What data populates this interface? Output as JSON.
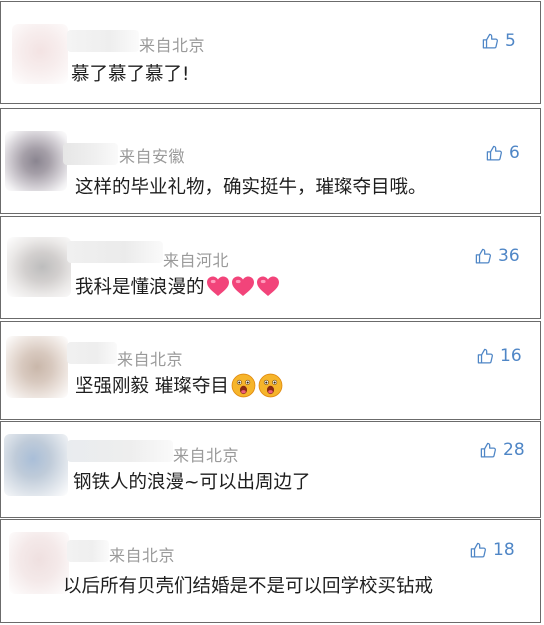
{
  "comments": [
    {
      "region": "来自北京",
      "text": "慕了慕了慕了!",
      "likes": "5",
      "emoji": null,
      "emoji_count": 0
    },
    {
      "region": "来自安徽",
      "text": "这样的毕业礼物，确实挺牛，璀璨夺目哦。",
      "likes": "6",
      "emoji": null,
      "emoji_count": 0
    },
    {
      "region": "来自河北",
      "text": "我科是懂浪漫的",
      "likes": "36",
      "emoji": "heart-emoji",
      "emoji_count": 3
    },
    {
      "region": "来自北京",
      "text": "坚强刚毅 璀璨夺目",
      "likes": "16",
      "emoji": "surprised-face-emoji",
      "emoji_count": 2
    },
    {
      "region": "来自北京",
      "text": "钢铁人的浪漫~可以出周边了",
      "likes": "28",
      "emoji": null,
      "emoji_count": 0
    },
    {
      "region": "来自北京",
      "text": "以后所有贝壳们结婚是不是可以回学校买钻戒",
      "likes": "18",
      "emoji": null,
      "emoji_count": 0
    }
  ],
  "icons": {
    "like": "thumbs-up-icon"
  },
  "colors": {
    "like": "#4f86c6",
    "region": "#9a9a9a",
    "text": "#1e1e1e",
    "border": "#6b6b6b"
  }
}
